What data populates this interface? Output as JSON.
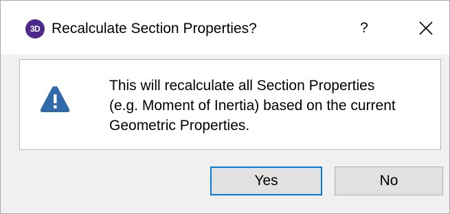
{
  "dialog": {
    "app_icon_text": "3D",
    "title": "Recalculate Section Properties?",
    "help_label": "?",
    "close_icon": "close-icon",
    "message_lines": [
      "This will recalculate all Section Properties",
      "(e.g. Moment of Inertia) based on the current",
      "Geometric Properties."
    ],
    "warning_icon": "warning-icon",
    "buttons": {
      "yes": "Yes",
      "no": "No"
    }
  },
  "colors": {
    "app_icon_bg": "#4b2a8c",
    "warning_fill": "#2e6aaa",
    "focus_border": "#0078d7"
  }
}
